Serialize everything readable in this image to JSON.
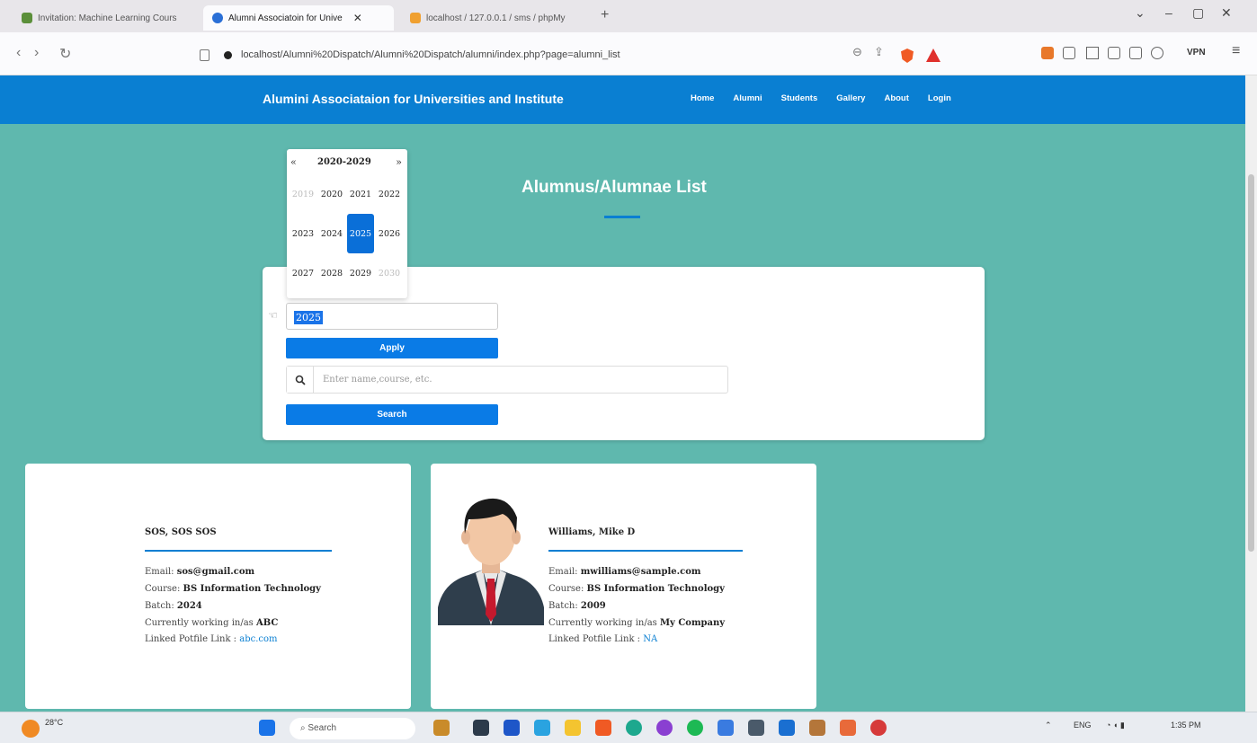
{
  "browser": {
    "tabs": [
      {
        "title": "Invitation: Machine Learning Cours",
        "active": false
      },
      {
        "title": "Alumni Associatoin for Unive",
        "active": true
      },
      {
        "title": "localhost / 127.0.0.1 / sms / phpMy",
        "active": false
      }
    ],
    "url": "localhost/Alumni%20Dispatch/Alumni%20Dispatch/alumni/index.php?page=alumni_list",
    "vpn_label": "VPN"
  },
  "site": {
    "brand": "Alumini Associataion for Universities and Institute",
    "nav": [
      "Home",
      "Alumni",
      "Students",
      "Gallery",
      "About",
      "Login"
    ]
  },
  "page": {
    "title": "Alumnus/Alumnae List",
    "batch_value": "2025",
    "apply_label": "Apply",
    "search_placeholder": "Enter name,course, etc.",
    "search_label": "Search"
  },
  "yearpicker": {
    "range": "2020-2029",
    "prev": "«",
    "next": "»",
    "years": [
      {
        "y": "2019",
        "state": "muted"
      },
      {
        "y": "2020",
        "state": "normal"
      },
      {
        "y": "2021",
        "state": "normal"
      },
      {
        "y": "2022",
        "state": "normal"
      },
      {
        "y": "2023",
        "state": "normal"
      },
      {
        "y": "2024",
        "state": "normal"
      },
      {
        "y": "2025",
        "state": "selected"
      },
      {
        "y": "2026",
        "state": "normal"
      },
      {
        "y": "2027",
        "state": "normal"
      },
      {
        "y": "2028",
        "state": "normal"
      },
      {
        "y": "2029",
        "state": "normal"
      },
      {
        "y": "2030",
        "state": "muted"
      }
    ]
  },
  "alumni": [
    {
      "name": "SOS, SOS SOS",
      "email_label": "Email: ",
      "email": "sos@gmail.com",
      "course_label": "Course: ",
      "course": "BS Information Technology",
      "batch_label": "Batch: ",
      "batch": "2024",
      "work_label": "Currently working in/as ",
      "work": "ABC",
      "link_label": "Linked Potfile Link : ",
      "link": "abc.com"
    },
    {
      "name": "Williams, Mike D",
      "email_label": "Email: ",
      "email": "mwilliams@sample.com",
      "course_label": "Course: ",
      "course": "BS Information Technology",
      "batch_label": "Batch: ",
      "batch": "2009",
      "work_label": "Currently working in/as ",
      "work": "My Company",
      "link_label": "Linked Potfile Link : ",
      "link": "NA"
    }
  ],
  "taskbar": {
    "temp": "28°C",
    "search_label": "Search",
    "lang": "ENG",
    "time": "1:35 PM"
  }
}
